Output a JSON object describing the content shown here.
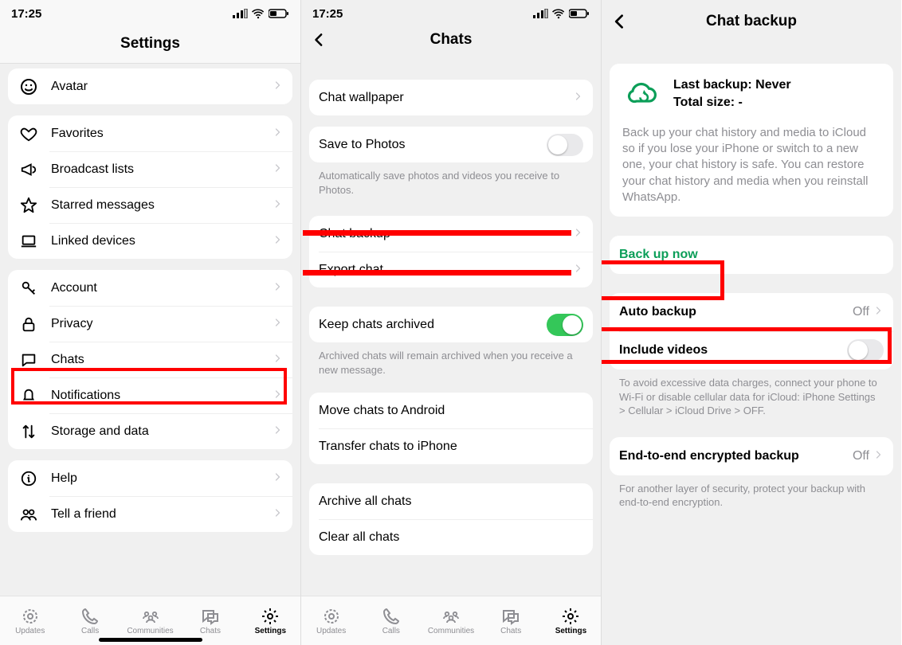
{
  "status_time": "17:25",
  "pane1": {
    "title": "Settings",
    "g1": [
      {
        "icon": "avatar",
        "label": "Avatar"
      }
    ],
    "g2": [
      {
        "icon": "heart",
        "label": "Favorites"
      },
      {
        "icon": "megaphone",
        "label": "Broadcast lists"
      },
      {
        "icon": "star",
        "label": "Starred messages"
      },
      {
        "icon": "laptop",
        "label": "Linked devices"
      }
    ],
    "g3": [
      {
        "icon": "key",
        "label": "Account"
      },
      {
        "icon": "lock",
        "label": "Privacy"
      },
      {
        "icon": "chat",
        "label": "Chats"
      },
      {
        "icon": "bell",
        "label": "Notifications"
      },
      {
        "icon": "updown",
        "label": "Storage and data"
      }
    ],
    "g4": [
      {
        "icon": "info",
        "label": "Help"
      },
      {
        "icon": "people",
        "label": "Tell a friend"
      }
    ]
  },
  "pane2": {
    "title": "Chats",
    "g1": [
      {
        "label": "Chat wallpaper"
      }
    ],
    "g2": [
      {
        "label": "Save to Photos"
      }
    ],
    "g2_foot": "Automatically save photos and videos you receive to Photos.",
    "g3": [
      {
        "label": "Chat backup"
      },
      {
        "label": "Export chat"
      }
    ],
    "g4": [
      {
        "label": "Keep chats archived"
      }
    ],
    "g4_foot": "Archived chats will remain archived when you receive a new message.",
    "g5": [
      {
        "label": "Move chats to Android"
      },
      {
        "label": "Transfer chats to iPhone"
      }
    ],
    "g6": [
      {
        "label": "Archive all chats"
      },
      {
        "label": "Clear all chats"
      }
    ]
  },
  "pane3": {
    "title": "Chat backup",
    "last_backup_label": "Last backup: Never",
    "total_size_label": "Total size: -",
    "desc": "Back up your chat history and media to iCloud so if you lose your iPhone or switch to a new one, your chat history is safe. You can restore your chat history and media when you reinstall WhatsApp.",
    "backup_now": "Back up now",
    "auto_backup_label": "Auto backup",
    "auto_backup_value": "Off",
    "include_videos_label": "Include videos",
    "wifi_note": "To avoid excessive data charges, connect your phone to Wi-Fi or disable cellular data for iCloud: iPhone Settings > Cellular > iCloud Drive > OFF.",
    "e2e_label": "End-to-end encrypted backup",
    "e2e_value": "Off",
    "e2e_foot": "For another layer of security, protect your backup with end-to-end encryption."
  },
  "tabs": [
    {
      "label": "Updates"
    },
    {
      "label": "Calls"
    },
    {
      "label": "Communities"
    },
    {
      "label": "Chats"
    },
    {
      "label": "Settings"
    }
  ]
}
